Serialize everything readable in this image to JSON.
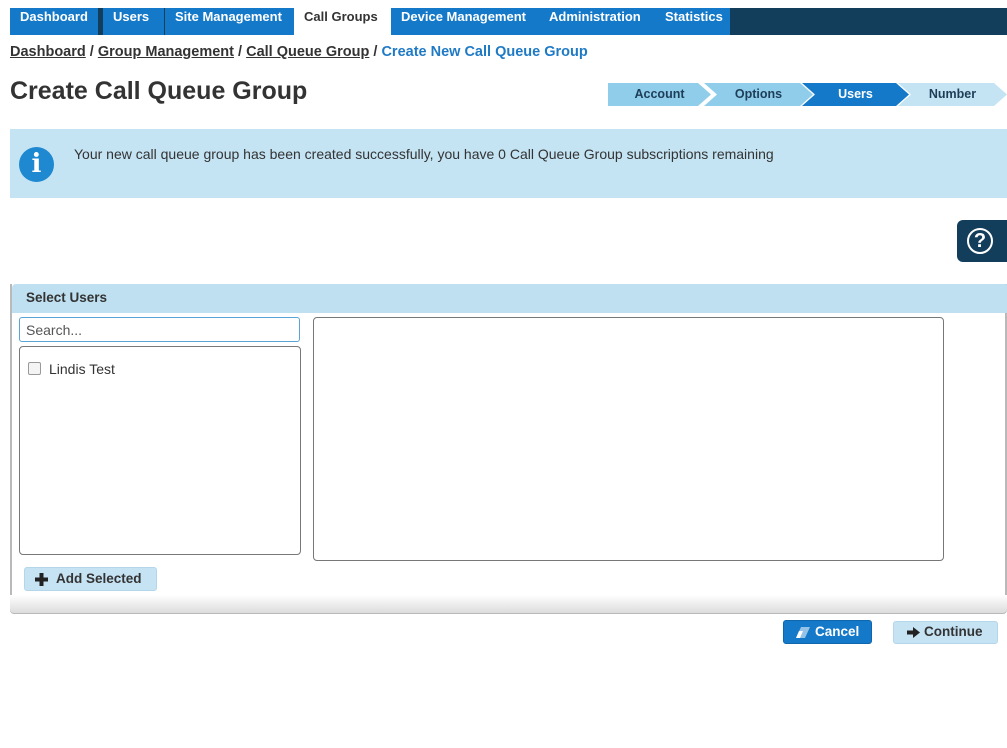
{
  "nav": {
    "tabs": [
      {
        "label": "Dashboard"
      },
      {
        "label": "Users"
      },
      {
        "label": "Site Management"
      },
      {
        "label": "Call Groups",
        "active": true
      },
      {
        "label": "Device Management"
      },
      {
        "label": "Administration"
      },
      {
        "label": "Statistics"
      }
    ]
  },
  "breadcrumb": {
    "items": [
      "Dashboard",
      "Group Management",
      "Call Queue Group"
    ],
    "current": "Create New Call Queue Group",
    "separator": "/"
  },
  "page": {
    "title": "Create Call Queue Group"
  },
  "wizard": {
    "steps": [
      {
        "label": "Account",
        "state": "done"
      },
      {
        "label": "Options",
        "state": "done"
      },
      {
        "label": "Users",
        "state": "active"
      },
      {
        "label": "Number",
        "state": "upcoming"
      }
    ]
  },
  "alert": {
    "icon": "info-icon",
    "message": "Your new call queue group has been created successfully, you have 0 Call Queue Group subscriptions remaining"
  },
  "help": {
    "icon": "help-icon",
    "glyph": "?"
  },
  "select_users": {
    "title": "Select Users",
    "search_placeholder": "Search...",
    "available_users": [
      {
        "name": "Lindis Test",
        "checked": false
      }
    ],
    "selected_users": [],
    "add_button": "Add Selected"
  },
  "actions": {
    "cancel": "Cancel",
    "continue": "Continue"
  },
  "colors": {
    "nav_background": "#123e5c",
    "tab_blue": "#1479c9",
    "alert_background": "#c4e3f4",
    "panel_header": "#bfe0f1",
    "link_blue": "#1f7ac5"
  }
}
